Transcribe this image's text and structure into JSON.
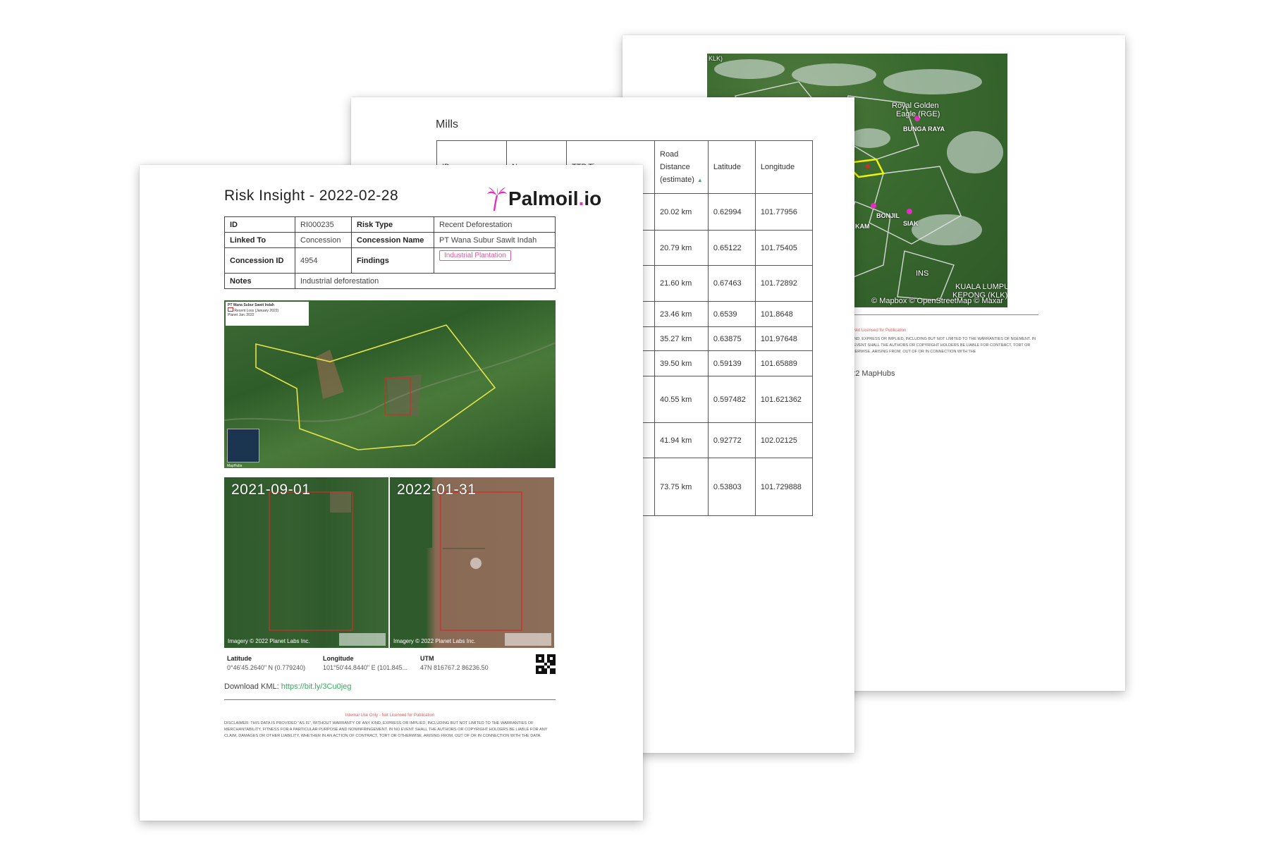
{
  "back_page": {
    "map_labels": {
      "top_left": "KLK)",
      "royal_golden": "Royal Golden",
      "eagle": "Eagle (RGE)",
      "bunga_raya": "BUNGA RAYA",
      "bonjil": "BONJIL",
      "siak": "SIAK",
      "kam": "KAM",
      "ins": "INS",
      "kuala_lumpur": "KUALA LUMPUR",
      "kepong": "KEPONG (KLK)"
    },
    "attribution": "© Mapbox © OpenStreetMap © Maxar",
    "internal_note": "ly - Not Licensed for Publication",
    "disclaimer": "Y KIND, EXPRESS OR IMPLIED, INCLUDING BUT NOT LIMITED TO THE WARRANTIES OF NGEMENT. IN NO EVENT SHALL THE AUTHORS OR COPYRIGHT HOLDERS BE LIABLE FOR CONTRACT, TORT OR OTHERWISE, ARISING FROM, OUT OF OR IN CONNECTION WITH THE",
    "copyright": "022 MapHubs"
  },
  "mills_page": {
    "title": "Mills",
    "headers": {
      "c1": "ID",
      "c2": "Na",
      "c3": "TTP Tier",
      "road_distance": "Road Distance (estimate)",
      "latitude": "Latitude",
      "longitude": "Longitude"
    },
    "rows": [
      {
        "road": "20.02 km",
        "lat": "0.62994",
        "lon": "101.77956"
      },
      {
        "road": "20.79 km",
        "lat": "0.65122",
        "lon": "101.75405"
      },
      {
        "road": "21.60 km",
        "lat": "0.67463",
        "lon": "101.72892"
      },
      {
        "road": "23.46 km",
        "lat": "0.6539",
        "lon": "101.8648"
      },
      {
        "road": "35.27 km",
        "lat": "0.63875",
        "lon": "101.97648"
      },
      {
        "road": "39.50 km",
        "lat": "0.59139",
        "lon": "101.65889"
      },
      {
        "road": "40.55 km",
        "lat": "0.597482",
        "lon": "101.621362"
      },
      {
        "road": "41.94 km",
        "lat": "0.92772",
        "lon": "102.02125"
      },
      {
        "road": "73.75 km",
        "lat": "0.53803",
        "lon": "101.729888"
      }
    ]
  },
  "front_page": {
    "title": "Risk Insight - 2022-02-28",
    "logo_name": "Palmoil",
    "logo_dot": ".",
    "logo_tld": "io",
    "info": {
      "id_label": "ID",
      "id_value": "RI000235",
      "risk_type_label": "Risk Type",
      "risk_type_value": "Recent Deforestation",
      "linked_label": "Linked To",
      "linked_value": "Concession",
      "conc_name_label": "Concession Name",
      "conc_name_value": "PT Wana Subur Sawit Indah",
      "conc_id_label": "Concession ID",
      "conc_id_value": "4954",
      "findings_label": "Findings",
      "findings_value": "Industrial Plantation",
      "notes_label": "Notes",
      "notes_value": "Industrial deforestation"
    },
    "overview_legend": {
      "name": "PT Wana Subur Sawit Indah",
      "line1": "Recent Loss (January 2022)",
      "line2": "Planet Jan. 2022"
    },
    "overview_logo": "MapHubs",
    "before": {
      "date": "2021-09-01",
      "attribution": "Imagery © 2022 Planet Labs Inc."
    },
    "after": {
      "date": "2022-01-31",
      "attribution": "Imagery © 2022 Planet Labs Inc."
    },
    "coords": {
      "lat_label": "Latitude",
      "lat_value": "0°46'45.2640\" N (0.779240)",
      "lon_label": "Longitude",
      "lon_value": "101°50'44.8440\" E (101.845...",
      "utm_label": "UTM",
      "utm_value": "47N 816767.2 86236.50"
    },
    "kml_label": "Download KML:",
    "kml_link": "https://bit.ly/3Cu0jeg",
    "internal_note": "Internal Use Only - Not Licensed for Publication",
    "disclaimer": "DISCLAIMER: THIS DATA IS PROVIDED \"AS IS\", WITHOUT WARRANTY OF ANY KIND, EXPRESS OR IMPLIED, INCLUDING BUT NOT LIMITED TO THE WARRANTIES OF MERCHANTABILITY, FITNESS FOR A PARTICULAR PURPOSE AND NONINFRINGEMENT. IN NO EVENT SHALL THE AUTHORS OR COPYRIGHT HOLDERS BE LIABLE FOR ANY CLAIM, DAMAGES OR OTHER LIABILITY, WHETHER IN AN ACTION OF CONTRACT, TORT OR OTHERWISE, ARISING FROM, OUT OF OR IN CONNECTION WITH THE DATA."
  },
  "colors": {
    "concession_outline": "#e3e34a",
    "deforestation_outline": "#d42b2b",
    "brand_magenta": "#e32fbf",
    "link_green": "#37a85a"
  }
}
